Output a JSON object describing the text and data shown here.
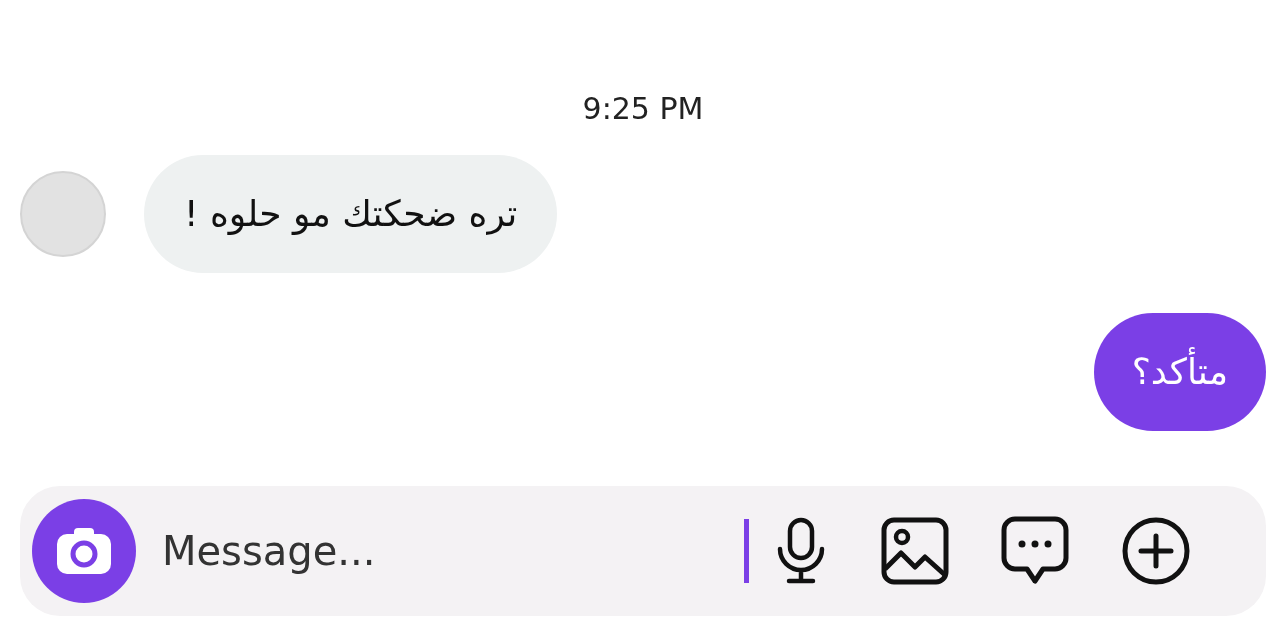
{
  "timestamp": "9:25 PM",
  "messages": [
    {
      "kind": "received",
      "text": "تره ضحكتك مو حلوه !"
    },
    {
      "kind": "sent",
      "text": "متأكد؟"
    }
  ],
  "composer": {
    "placeholder": "Message...",
    "focused": true
  }
}
